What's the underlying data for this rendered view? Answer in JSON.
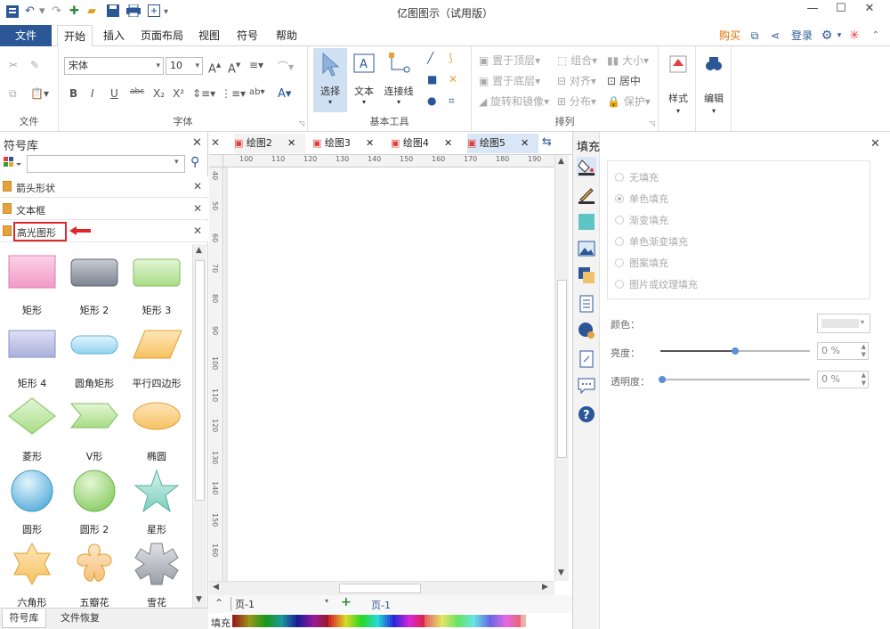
{
  "app": {
    "title": "亿图图示（试用版）"
  },
  "menu": {
    "file": "文件",
    "tabs": [
      "开始",
      "插入",
      "页面布局",
      "视图",
      "符号",
      "帮助"
    ],
    "buy": "购买",
    "login": "登录"
  },
  "ribbon": {
    "font_name": "宋体",
    "font_size": "10",
    "groups": {
      "file": "文件",
      "font": "字体",
      "basic_tools": "基本工具",
      "arrange": "排列"
    },
    "tools": {
      "select": "选择",
      "text": "文本",
      "connector": "连接线"
    },
    "arrange": {
      "bring_front": "置于顶层",
      "send_back": "置于底层",
      "rotate": "旋转和镜像",
      "group": "组合",
      "align": "对齐",
      "distribute": "分布",
      "size": "大小",
      "center": "居中",
      "protect": "保护"
    },
    "style": "样式",
    "edit": "编辑"
  },
  "library": {
    "title": "符号库",
    "search_placeholder": "",
    "categories": [
      "箭头形状",
      "文本框",
      "高光图形"
    ],
    "shapes": [
      "矩形",
      "矩形 2",
      "矩形 3",
      "矩形 4",
      "圆角矩形",
      "平行四边形",
      "菱形",
      "V形",
      "椭圆",
      "圆形",
      "圆形 2",
      "星形",
      "六角形",
      "五瓣花",
      "雪花"
    ],
    "bottom_tabs": [
      "符号库",
      "文件恢复"
    ]
  },
  "canvas": {
    "tabs": [
      "绘图2",
      "绘图3",
      "绘图4",
      "绘图5"
    ],
    "ruler_h": [
      "100",
      "110",
      "120",
      "130",
      "140",
      "150",
      "160",
      "170",
      "180",
      "190"
    ],
    "ruler_v": [
      "40",
      "50",
      "60",
      "70",
      "80",
      "90",
      "100",
      "110",
      "120",
      "130",
      "140",
      "150",
      "160"
    ],
    "page_select": "页-1",
    "page_tab": "页-1",
    "fill_label": "填充"
  },
  "fill_panel": {
    "title": "填充",
    "options": [
      "无填充",
      "单色填充",
      "渐变填充",
      "单色渐变填充",
      "图案填充",
      "图片或纹理填充"
    ],
    "selected_option": "单色填充",
    "color_label": "颜色：",
    "brightness_label": "亮度：",
    "brightness_value": "0 %",
    "transparency_label": "透明度：",
    "transparency_value": "0 %"
  },
  "colors": {
    "accent": "#2b5797",
    "highlight_box": "#e0262b",
    "panel_bg": "#f3f3f3"
  }
}
